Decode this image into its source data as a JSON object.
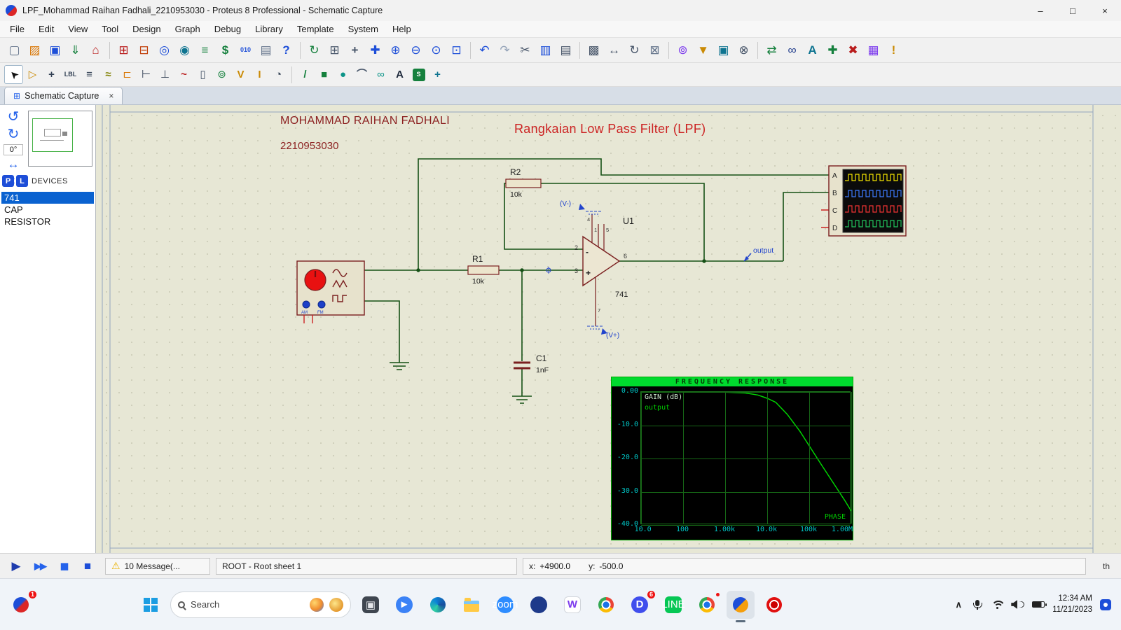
{
  "window": {
    "title": "LPF_Mohammad Raihan Fadhali_2210953030 - Proteus 8 Professional - Schematic Capture",
    "minimize": "–",
    "maximize": "□",
    "close": "×"
  },
  "menubar": {
    "items": [
      "File",
      "Edit",
      "View",
      "Tool",
      "Design",
      "Graph",
      "Debug",
      "Library",
      "Template",
      "System",
      "Help"
    ]
  },
  "toolbar_main": {
    "items": [
      {
        "n": "new-project-button",
        "g": "▢",
        "c": "#64748b"
      },
      {
        "n": "open-project-button",
        "g": "▨",
        "c": "#d97706"
      },
      {
        "n": "save-project-button",
        "g": "▣",
        "c": "#1d4ed8"
      },
      {
        "n": "import-project-button",
        "g": "⇓",
        "c": "#15803d"
      },
      {
        "n": "home-page-button",
        "g": "⌂",
        "c": "#b91c1c"
      },
      {
        "sep": true
      },
      {
        "n": "schematic-capture-button",
        "g": "⊞",
        "c": "#b91c1c"
      },
      {
        "n": "pcb-layout-button",
        "g": "⊟",
        "c": "#c2410c"
      },
      {
        "n": "3d-visualizer-button",
        "g": "◎",
        "c": "#1d4ed8"
      },
      {
        "n": "gerber-viewer-button",
        "g": "◉",
        "c": "#0e7490"
      },
      {
        "n": "design-explorer-button",
        "g": "≡",
        "c": "#15803d"
      },
      {
        "n": "bill-of-materials-button",
        "g": "$",
        "c": "#15803d",
        "bold": true
      },
      {
        "n": "simulation-log-button",
        "g": "010",
        "c": "#1d4ed8",
        "small": true
      },
      {
        "n": "release-notes-button",
        "g": "▤",
        "c": "#64748b"
      },
      {
        "n": "help-button",
        "g": "?",
        "c": "#1d4ed8",
        "bold": true
      },
      {
        "sep": true
      },
      {
        "n": "redraw-button",
        "g": "↻",
        "c": "#15803d"
      },
      {
        "n": "grid-toggle-button",
        "g": "⊞",
        "c": "#475569"
      },
      {
        "n": "origin-button",
        "g": "+",
        "c": "#475569",
        "bold": true
      },
      {
        "n": "pan-button",
        "g": "✚",
        "c": "#1d4ed8"
      },
      {
        "n": "zoom-in-button",
        "g": "⊕",
        "c": "#1d4ed8"
      },
      {
        "n": "zoom-out-button",
        "g": "⊖",
        "c": "#1d4ed8"
      },
      {
        "n": "zoom-extents-button",
        "g": "⊙",
        "c": "#1d4ed8"
      },
      {
        "n": "zoom-area-button",
        "g": "⊡",
        "c": "#1d4ed8"
      },
      {
        "sep": true
      },
      {
        "n": "undo-button",
        "g": "↶",
        "c": "#1d4ed8"
      },
      {
        "n": "redo-button",
        "g": "↷",
        "c": "#94a3b8"
      },
      {
        "n": "cut-button",
        "g": "✂",
        "c": "#475569"
      },
      {
        "n": "copy-button",
        "g": "▥",
        "c": "#1d4ed8"
      },
      {
        "n": "paste-button",
        "g": "▤",
        "c": "#475569"
      },
      {
        "sep": true
      },
      {
        "n": "block-copy-button",
        "g": "▩",
        "c": "#475569"
      },
      {
        "n": "block-move-button",
        "g": "↔",
        "c": "#475569"
      },
      {
        "n": "block-rotate-button",
        "g": "↻",
        "c": "#475569"
      },
      {
        "n": "block-delete-button",
        "g": "⊠",
        "c": "#64748b"
      },
      {
        "sep": true
      },
      {
        "n": "pick-parts-button",
        "g": "⊚",
        "c": "#7c3aed"
      },
      {
        "n": "make-device-button",
        "g": "▼",
        "c": "#ca8a04"
      },
      {
        "n": "packaging-tool-button",
        "g": "▣",
        "c": "#0e7490"
      },
      {
        "n": "decompose-button",
        "g": "⊗",
        "c": "#475569"
      },
      {
        "sep": true
      },
      {
        "n": "wire-autorouter-button",
        "g": "⇄",
        "c": "#15803d"
      },
      {
        "n": "search-components-button",
        "g": "∞",
        "c": "#1e3a8a"
      },
      {
        "n": "property-assignment-button",
        "g": "A",
        "c": "#0e7490",
        "bold": true
      },
      {
        "n": "new-sheet-button",
        "g": "✚",
        "c": "#15803d"
      },
      {
        "n": "remove-sheet-button",
        "g": "✖",
        "c": "#b91c1c"
      },
      {
        "n": "goto-sheet-button",
        "g": "▦",
        "c": "#7c3aed"
      },
      {
        "n": "design-rule-check-button",
        "g": "!",
        "c": "#ca8a04",
        "bold": true
      }
    ]
  },
  "toolbar_mode": {
    "items": [
      {
        "n": "selection-mode-button",
        "g": "➤",
        "c": "#111111",
        "rot": -135,
        "pressed": true
      },
      {
        "n": "component-mode-button",
        "g": "▷",
        "c": "#ca8a04"
      },
      {
        "n": "junction-dot-mode-button",
        "g": "+",
        "c": "#334155",
        "bold": true
      },
      {
        "n": "wire-label-mode-button",
        "g": "LBL",
        "c": "#334155",
        "small": true
      },
      {
        "n": "text-script-mode-button",
        "g": "≡",
        "c": "#334155"
      },
      {
        "n": "buses-mode-button",
        "g": "≈",
        "c": "#808000",
        "bold": true
      },
      {
        "n": "subcircuit-mode-button",
        "g": "⊏",
        "c": "#d97706"
      },
      {
        "n": "terminals-mode-button",
        "g": "⊢",
        "c": "#334155"
      },
      {
        "n": "device-pins-mode-button",
        "g": "⊥",
        "c": "#334155"
      },
      {
        "n": "graph-mode-button",
        "g": "~",
        "c": "#b91c1c",
        "bold": true
      },
      {
        "n": "tape-recorder-mode-button",
        "g": "▯",
        "c": "#475569"
      },
      {
        "n": "generator-mode-button",
        "g": "⊚",
        "c": "#15803d"
      },
      {
        "n": "voltage-probe-mode-button",
        "g": "V",
        "c": "#ca8a04",
        "bold": true
      },
      {
        "n": "current-probe-mode-button",
        "g": "I",
        "c": "#ca8a04",
        "bold": true
      },
      {
        "n": "virtual-instruments-mode-button",
        "g": "◔",
        "c": "#334155"
      },
      {
        "sep": true
      },
      {
        "n": "2d-line-button",
        "g": "/",
        "c": "#15803d",
        "bold": true
      },
      {
        "n": "2d-box-button",
        "g": "■",
        "c": "#15803d"
      },
      {
        "n": "2d-circle-button",
        "g": "●",
        "c": "#0d9488"
      },
      {
        "n": "2d-arc-button",
        "g": "⌒",
        "c": "#475569",
        "bold": true
      },
      {
        "n": "2d-path-button",
        "g": "∞",
        "c": "#0d9488"
      },
      {
        "n": "2d-text-button",
        "g": "A",
        "c": "#1e293b",
        "bold": true
      },
      {
        "n": "2d-symbol-button",
        "g": "S",
        "c": "#ffffff",
        "bg": "#15803d",
        "small": true
      },
      {
        "n": "2d-marker-button",
        "g": "+",
        "c": "#0e7490",
        "bold": true
      }
    ]
  },
  "tab": {
    "icon": "⊞",
    "label": "Schematic Capture",
    "close": "×"
  },
  "sidebar": {
    "rotate_ccw": "↺",
    "rotate_cw": "↻",
    "angle": "0°",
    "flip_h": "↔",
    "flip_v": "↕",
    "pick_label": "P",
    "library_label": "L",
    "devices_label": "DEVICES",
    "devices": [
      {
        "label": "741",
        "sel": true
      },
      {
        "label": "CAP"
      },
      {
        "label": "RESISTOR"
      }
    ]
  },
  "schematic": {
    "author_line1": "MOHAMMAD RAIHAN FADHALI",
    "author_line2": "2210953030",
    "title": "Rangkaian Low Pass Filter (LPF)",
    "r1_ref": "R1",
    "r1_val": "10k",
    "r2_ref": "R2",
    "r2_val": "10k",
    "c1_ref": "C1",
    "c1_val": "1nF",
    "u1_ref": "U1",
    "u1_val": "741",
    "pin1": "1",
    "pin2": "2",
    "pin3": "3",
    "pin4": "4",
    "pin5": "5",
    "pin6": "6",
    "pin7": "7",
    "plus": "+",
    "minus": "-",
    "vminus_label": "(V-)",
    "vplus_label": "(V+)",
    "probe_label": "output",
    "gen_am": "AM",
    "gen_fm": "FM",
    "scope_a": "A",
    "scope_b": "B",
    "scope_c": "C",
    "scope_d": "D"
  },
  "chart_data": {
    "type": "line",
    "title": "FREQUENCY RESPONSE",
    "ylabel_text": "GAIN (dB)",
    "legend_label": "output",
    "phase_label": "PHASE",
    "x_ticks": [
      "10.0",
      "100",
      "1.00k",
      "10.0k",
      "100k",
      "1.00M"
    ],
    "y_ticks": [
      "0.00",
      "-10.0",
      "-20.0",
      "-30.0",
      "-40.0"
    ],
    "xscale": "log",
    "xlim": [
      10,
      1000000
    ],
    "ylim": [
      -40,
      0
    ],
    "grid": true,
    "legend_position": "top-left",
    "series": [
      {
        "name": "output",
        "points": [
          [
            10,
            0
          ],
          [
            100,
            0
          ],
          [
            1000,
            -0.05
          ],
          [
            3000,
            -0.3
          ],
          [
            6000,
            -0.9
          ],
          [
            10000,
            -1.9
          ],
          [
            16000,
            -3.1
          ],
          [
            30000,
            -6.7
          ],
          [
            60000,
            -11.8
          ],
          [
            100000,
            -16.2
          ],
          [
            200000,
            -22.1
          ],
          [
            400000,
            -27.9
          ],
          [
            700000,
            -32.6
          ],
          [
            1000000,
            -35.8
          ]
        ]
      }
    ]
  },
  "statusbar": {
    "sim": [
      {
        "n": "run-simulation-button",
        "g": "▶",
        "c": "#1e3cae"
      },
      {
        "n": "step-simulation-button",
        "g": "▶▶",
        "c": "#2563eb",
        "small": true
      },
      {
        "n": "pause-simulation-button",
        "g": "▮▮",
        "c": "#2563eb",
        "small": true
      },
      {
        "n": "stop-simulation-button",
        "g": "■",
        "c": "#1d4ed8"
      }
    ],
    "warning_icon": "⚠",
    "messages": "10 Message(...",
    "sheet": "ROOT - Root sheet 1",
    "x_label": "x:",
    "x_value": "+4900.0",
    "y_label": "y:",
    "y_value": "-500.0",
    "right_text": "th"
  },
  "taskbar": {
    "search_label": "Search",
    "corner_badge": "1",
    "tray_chevron": "∧",
    "time": "12:34 AM",
    "date": "11/21/2023",
    "apps": [
      {
        "n": "taskbar-app-window",
        "type": "glyph",
        "g": "▣",
        "c": "#e5e7eb",
        "bg": "#3f4650"
      },
      {
        "n": "taskbar-app-camera",
        "type": "glyph",
        "g": "►",
        "c": "#ffffff",
        "bg": "#3b82f6",
        "round": true
      },
      {
        "n": "taskbar-app-edge",
        "type": "edge"
      },
      {
        "n": "taskbar-app-file-explorer",
        "type": "folder"
      },
      {
        "n": "taskbar-app-zoom",
        "type": "glyph",
        "g": "zoom",
        "c": "#ffffff",
        "bg": "#2d8cff",
        "tiny": true,
        "round": true
      },
      {
        "n": "taskbar-app-media",
        "type": "glyph",
        "g": "",
        "bg": "#1e3a8a",
        "round": true
      },
      {
        "n": "taskbar-app-wondershare",
        "type": "glyph",
        "g": "W",
        "c": "#7c3aed",
        "bg": "#ffffff",
        "border": true,
        "bold": true
      },
      {
        "n": "taskbar-app-chrome",
        "type": "chrome"
      },
      {
        "n": "taskbar-app-discord",
        "type": "glyph",
        "g": "D",
        "c": "#ffffff",
        "bg": "#404eed",
        "round": true,
        "badge": "6",
        "bold": true
      },
      {
        "n": "taskbar-app-line",
        "type": "glyph",
        "g": "LINE",
        "c": "#ffffff",
        "bg": "#06c755",
        "tiny": true
      },
      {
        "n": "taskbar-app-chrome-profile",
        "type": "chrome",
        "badge": ""
      },
      {
        "n": "taskbar-app-proteus",
        "type": "proteus",
        "active": true
      },
      {
        "n": "taskbar-app-record",
        "type": "record"
      }
    ]
  }
}
